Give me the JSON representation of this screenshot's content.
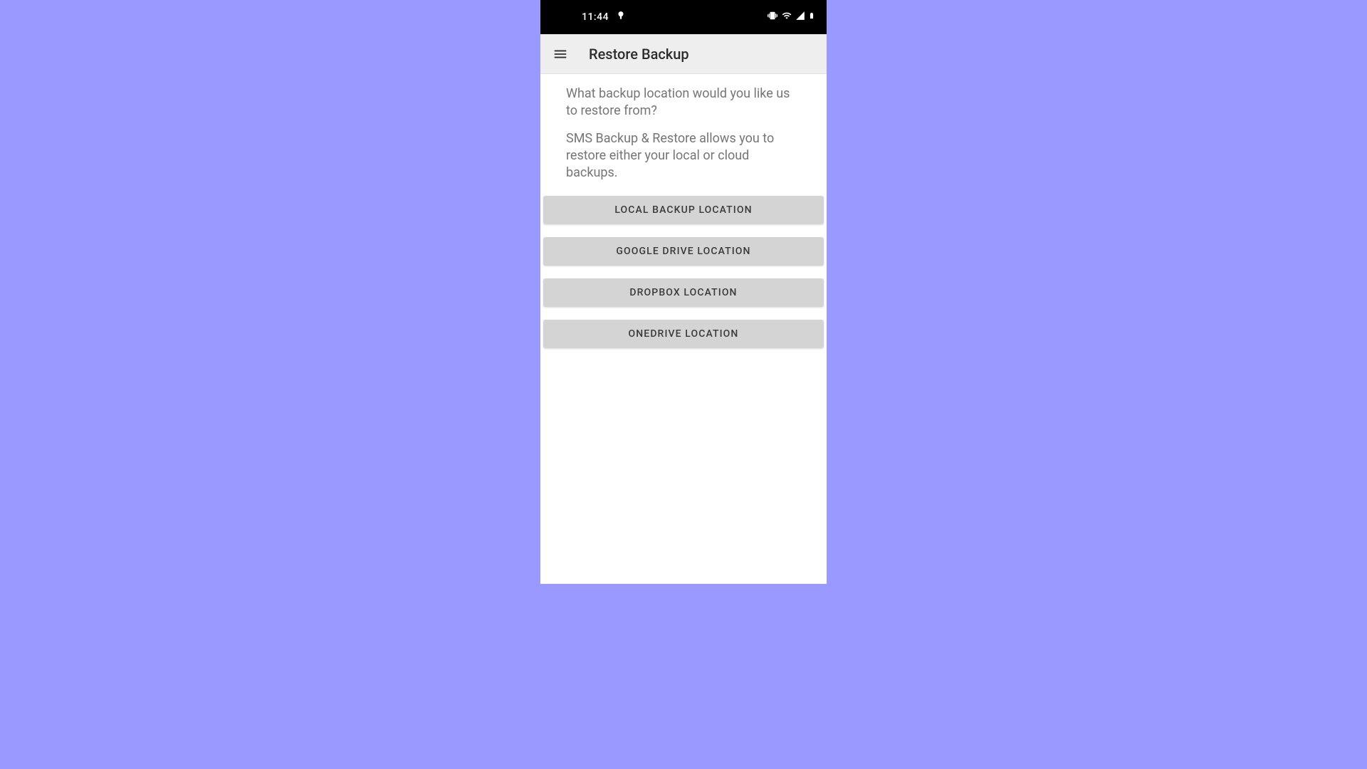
{
  "status_bar": {
    "time": "11:44",
    "notification_icon": "food-delivery-icon",
    "system_icons": {
      "vibrate": "vibrate-icon",
      "wifi": "wifi-icon",
      "signal": "signal-icon",
      "battery": "battery-icon"
    }
  },
  "app_bar": {
    "menu_icon": "hamburger-menu-icon",
    "title": "Restore Backup"
  },
  "content": {
    "prompt": "What backup location would you like us to restore from?",
    "description": "SMS Backup & Restore allows you to restore either your local or cloud backups."
  },
  "buttons": [
    {
      "label": "LOCAL BACKUP LOCATION",
      "name": "local-backup-button"
    },
    {
      "label": "GOOGLE DRIVE LOCATION",
      "name": "google-drive-button"
    },
    {
      "label": "DROPBOX LOCATION",
      "name": "dropbox-button"
    },
    {
      "label": "ONEDRIVE LOCATION",
      "name": "onedrive-button"
    }
  ],
  "colors": {
    "page_background": "#9999ff",
    "status_bar_bg": "#000000",
    "app_bar_bg": "#eeeeee",
    "button_bg": "#d4d4d4",
    "text_primary": "#2d2d2d",
    "text_secondary": "#757575"
  }
}
